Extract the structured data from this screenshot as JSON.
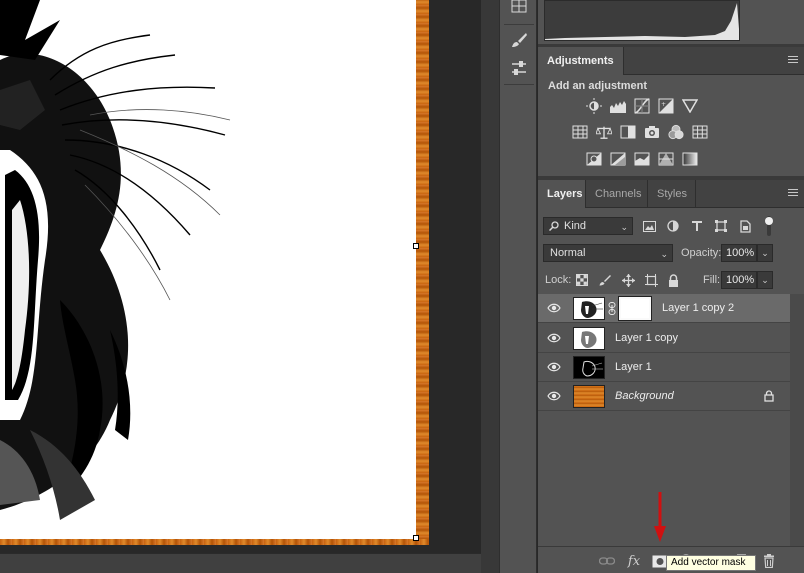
{
  "adjustments": {
    "tab_label": "Adjustments",
    "heading": "Add an adjustment"
  },
  "layers_panel": {
    "tabs": [
      {
        "label": "Layers",
        "active": true
      },
      {
        "label": "Channels",
        "active": false
      },
      {
        "label": "Styles",
        "active": false
      }
    ],
    "filter_kind": "Kind",
    "blend_mode": "Normal",
    "opacity_label": "Opacity:",
    "opacity_value": "100%",
    "lock_label": "Lock:",
    "fill_label": "Fill:",
    "fill_value": "100%",
    "layers": [
      {
        "name": "Layer 1 copy 2",
        "selected": true,
        "has_mask": true,
        "italic": false,
        "locked": false
      },
      {
        "name": "Layer 1 copy",
        "selected": false,
        "has_mask": false,
        "italic": false,
        "locked": false
      },
      {
        "name": "Layer 1",
        "selected": false,
        "has_mask": false,
        "italic": false,
        "locked": false
      },
      {
        "name": "Background",
        "selected": false,
        "has_mask": false,
        "italic": true,
        "locked": true
      }
    ]
  },
  "bottom_bar": {
    "fx_label": "fx"
  },
  "tooltip": {
    "text": "Add vector mask"
  },
  "colors": {
    "panel_bg": "#535353",
    "selected_row": "#6a6a6a",
    "frame_orange": "#c86410",
    "arrow_red": "#d01010"
  }
}
